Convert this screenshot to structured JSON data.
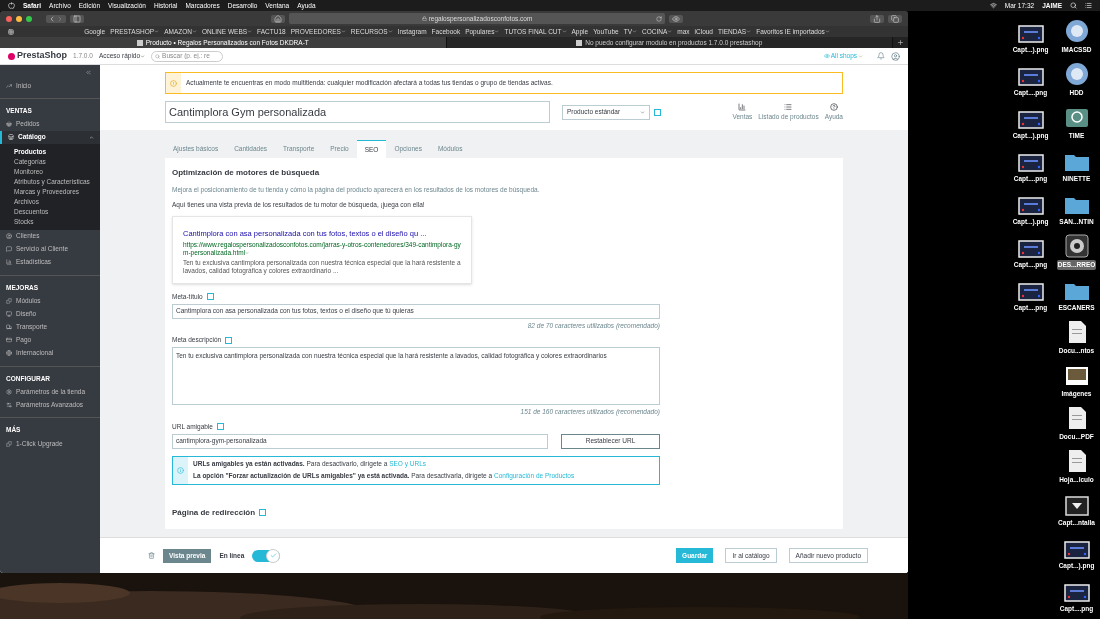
{
  "menubar": {
    "app": "Safari",
    "menus": [
      "Archivo",
      "Edición",
      "Visualización",
      "Historial",
      "Marcadores",
      "Desarrollo",
      "Ventana",
      "Ayuda"
    ],
    "clock": "Mar 17:32",
    "user": "JAIME"
  },
  "browser": {
    "url": "regalospersonalizadosconfotos.com",
    "bookmarks": [
      {
        "label": "Google",
        "menu": false
      },
      {
        "label": "PRESTASHOP",
        "menu": true
      },
      {
        "label": "AMAZON",
        "menu": true
      },
      {
        "label": "ONLINE WEBS",
        "menu": true
      },
      {
        "label": "FACTU18",
        "menu": false
      },
      {
        "label": "PROVEEDORES",
        "menu": true
      },
      {
        "label": "RECURSOS",
        "menu": true
      },
      {
        "label": "Instagram",
        "menu": false
      },
      {
        "label": "Facebook",
        "menu": false
      },
      {
        "label": "Populares",
        "menu": true
      },
      {
        "label": "TUTOS FINAL CUT",
        "menu": true
      },
      {
        "label": "Apple",
        "menu": false
      },
      {
        "label": "YouTube",
        "menu": false
      },
      {
        "label": "TV",
        "menu": true
      },
      {
        "label": "COCINA",
        "menu": true
      },
      {
        "label": "max",
        "menu": false
      },
      {
        "label": "iCloud",
        "menu": false
      },
      {
        "label": "TIENDAS",
        "menu": true
      },
      {
        "label": "Favoritos IE importados",
        "menu": true
      }
    ],
    "tabs": [
      {
        "title": "Producto • Regalos Personalizados con Fotos DKDRA-T",
        "selected": true
      },
      {
        "title": "No puedo configurar modulo en productos 1.7.0.0 prestashop",
        "selected": false
      }
    ]
  },
  "header": {
    "logo": "PrestaShop",
    "version": "1.7.0.0",
    "quick_access": "Acceso rápido",
    "search_placeholder": "Buscar (p. ej.: re",
    "shops": "All shops"
  },
  "sidebar": {
    "sections": [
      {
        "items": [
          {
            "label": "Inicio",
            "selected": false
          }
        ]
      },
      {
        "title": "VENTAS",
        "items": [
          {
            "label": "Pedidos",
            "selected": false
          },
          {
            "label": "Catálogo",
            "selected": true,
            "expanded": true,
            "children": [
              {
                "label": "Productos",
                "selected": true
              },
              {
                "label": "Categorías",
                "selected": false
              },
              {
                "label": "Monitoreo",
                "selected": false
              },
              {
                "label": "Atributos y Características",
                "selected": false
              },
              {
                "label": "Marcas y Proveedores",
                "selected": false
              },
              {
                "label": "Archivos",
                "selected": false
              },
              {
                "label": "Descuentos",
                "selected": false
              },
              {
                "label": "Stocks",
                "selected": false
              }
            ]
          },
          {
            "label": "Clientes",
            "selected": false
          },
          {
            "label": "Servicio al Cliente",
            "selected": false
          },
          {
            "label": "Estadísticas",
            "selected": false
          }
        ]
      },
      {
        "title": "MEJORAS",
        "items": [
          {
            "label": "Módulos",
            "selected": false
          },
          {
            "label": "Diseño",
            "selected": false
          },
          {
            "label": "Transporte",
            "selected": false
          },
          {
            "label": "Pago",
            "selected": false
          },
          {
            "label": "Internacional",
            "selected": false
          }
        ]
      },
      {
        "title": "CONFIGURAR",
        "items": [
          {
            "label": "Parámetros de la tienda",
            "selected": false
          },
          {
            "label": "Parámetros Avanzados",
            "selected": false
          }
        ]
      },
      {
        "title": "MÁS",
        "items": [
          {
            "label": "1-Click Upgrade",
            "selected": false
          }
        ]
      }
    ]
  },
  "alert": "Actualmente te encuentras en modo multitienda: cualquier modificación afectará a todas tus tiendas o grupo de tiendas activas.",
  "product": {
    "name": "Cantimplora Gym personalizada",
    "type": "Producto estándar"
  },
  "toolbar": [
    "Ventas",
    "Listado de productos",
    "Ayuda"
  ],
  "product_tabs": [
    {
      "label": "Ajustes básicos",
      "selected": false
    },
    {
      "label": "Cantidades",
      "selected": false
    },
    {
      "label": "Transporte",
      "selected": false
    },
    {
      "label": "Precio",
      "selected": false
    },
    {
      "label": "SEO",
      "selected": true
    },
    {
      "label": "Opciones",
      "selected": false
    },
    {
      "label": "Módulos",
      "selected": false
    }
  ],
  "seo": {
    "title": "Optimización de motores de búsqueda",
    "subtitle": "Mejora el posicionamiento de tu tienda y cómo la página del producto aparecerá en los resultados de los motores de búsqueda.",
    "preview_intro": "Aquí tienes una vista previa de los resultados de tu motor de búsqueda, ¡juega con ella!",
    "preview": {
      "title": "Cantimplora con asa personalizada con tus fotos, textos o el diseño qu ...",
      "url": "https://www.regalospersonalizadosconfotos.com/jarras-y-otros-contenedores/349-cantimplora-gym-personalizada.html",
      "description": "Ten tu exclusiva cantimplora personalizada con nuestra técnica especial que la hará resistente a lavados, calidad fotográfica y colores extraordinario ..."
    },
    "meta_title": {
      "label": "Meta-título",
      "value": "Cantimplora con asa personalizada con tus fotos, textos o el diseño que tú quieras",
      "counter": "82 de 70 caracteres utilizados (recomendado)"
    },
    "meta_description": {
      "label": "Meta descripción",
      "value": "Ten tu exclusiva cantimplora personalizada con nuestra técnica especial que la hará resistente a lavados, calidad fotográfica y colores extraordinarios",
      "counter": "151 de 160 caracteres utilizados (recomendado)"
    },
    "friendly_url": {
      "label": "URL amigable",
      "value": "cantimplora-gym-personalizada",
      "button": "Restablecer URL"
    },
    "info": [
      {
        "text": "**URLs amigables ya están activadas.** Para desactivarlo, dirígete a",
        "link": "SEO y URLs"
      },
      {
        "text": "**La opción \"Forzar actualización de URLs amigables\" ya está activada.** Para desactivarla, dirígete a",
        "link": "Configuración de Productos"
      }
    ],
    "redirect_title": "Página de redirección"
  },
  "footer": {
    "preview": "Vista previa",
    "online": {
      "label": "En línea",
      "on": true
    },
    "buttons": [
      "Guardar",
      "Ir al catálogo",
      "Añadir nuevo producto"
    ]
  },
  "desktop": {
    "columns": [
      [
        {
          "label": "Capt...).png",
          "kind": "screenshot",
          "selected": false
        },
        {
          "label": "Capt....png",
          "kind": "screenshot",
          "selected": false
        },
        {
          "label": "Capt...).png",
          "kind": "screenshot",
          "selected": false
        },
        {
          "label": "Capt....png",
          "kind": "screenshot",
          "selected": false
        },
        {
          "label": "Capt...).png",
          "kind": "screenshot",
          "selected": false
        },
        {
          "label": "Capt....png",
          "kind": "screenshot",
          "selected": false
        },
        {
          "label": "Capt....png",
          "kind": "screenshot",
          "selected": false
        }
      ],
      [
        {
          "label": "IMACSSD",
          "kind": "disk",
          "selected": false
        },
        {
          "label": "HDD",
          "kind": "disk",
          "selected": false
        },
        {
          "label": "TIME",
          "kind": "backup",
          "selected": false
        },
        {
          "label": "NINETTE",
          "kind": "folder",
          "selected": false
        },
        {
          "label": "SAN...NTIN",
          "kind": "folder",
          "selected": false
        },
        {
          "label": "DES...RREO",
          "kind": "utility",
          "selected": true
        },
        {
          "label": "ESCANERS",
          "kind": "folder",
          "selected": false
        },
        {
          "label": "Docu...ntos",
          "kind": "document",
          "selected": false
        },
        {
          "label": "Imágenes",
          "kind": "photos",
          "selected": false
        },
        {
          "label": "Docu...PDF",
          "kind": "document",
          "selected": false
        },
        {
          "label": "Hoja...lculo",
          "kind": "document",
          "selected": false
        },
        {
          "label": "Capt...ntalla",
          "kind": "download",
          "selected": false
        },
        {
          "label": "Capt...).png",
          "kind": "screenshot",
          "selected": false
        },
        {
          "label": "Capt....png",
          "kind": "screenshot",
          "selected": false
        }
      ]
    ]
  }
}
